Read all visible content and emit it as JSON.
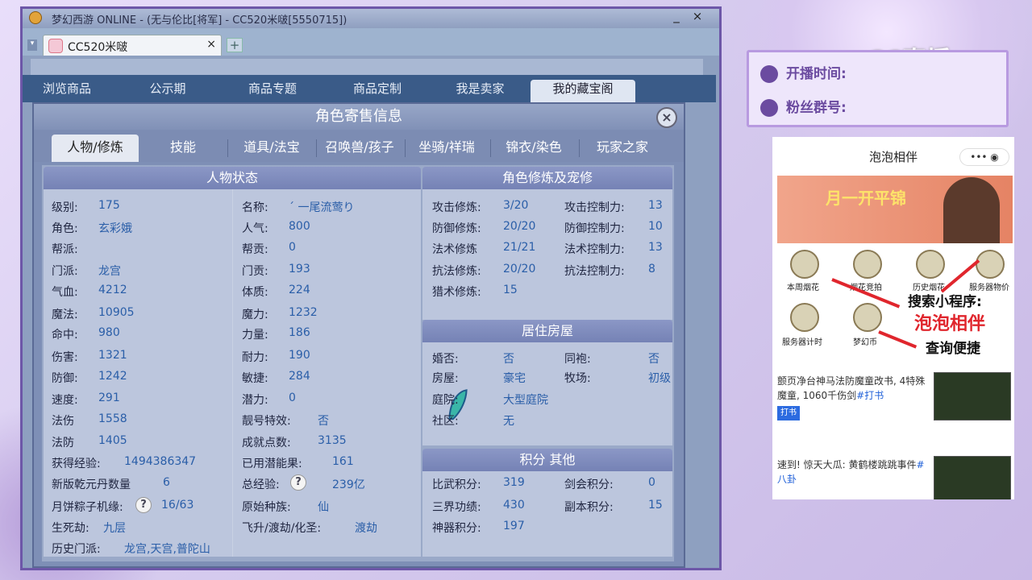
{
  "window": {
    "title": "梦幻西游 ONLINE - (无与伦比[将军] - CC520米啵[5550715])"
  },
  "browser": {
    "tab_label": "CC520米啵",
    "tab_close": "×",
    "new_tab": "+"
  },
  "site_nav": [
    "浏览商品",
    "公示期",
    "商品专题",
    "商品定制",
    "我是卖家",
    "我的藏宝阁"
  ],
  "dialog": {
    "title": "角色寄售信息",
    "close": "×",
    "tabs": [
      "人物/修炼",
      "技能",
      "道具/法宝",
      "召唤兽/孩子",
      "坐骑/祥瑞",
      "锦衣/染色",
      "玩家之家"
    ]
  },
  "char_status": {
    "heading": "人物状态",
    "left": [
      {
        "label": "级别:",
        "value": "175"
      },
      {
        "label": "角色:",
        "value": "玄彩娥"
      },
      {
        "label": "帮派:",
        "value": ""
      },
      {
        "label": "门派:",
        "value": "龙宫"
      },
      {
        "label": "气血:",
        "value": "4212"
      },
      {
        "label": "魔法:",
        "value": "10905"
      },
      {
        "label": "命中:",
        "value": "980"
      },
      {
        "label": "伤害:",
        "value": "1321"
      },
      {
        "label": "防御:",
        "value": "1242"
      },
      {
        "label": "速度:",
        "value": "291"
      },
      {
        "label": "法伤",
        "value": "1558"
      },
      {
        "label": "法防",
        "value": "1405"
      },
      {
        "label": "获得经验:",
        "value": "1494386347"
      },
      {
        "label": "新版乾元丹数量",
        "value": "6"
      },
      {
        "label": "月饼粽子机缘:",
        "value": "16/63"
      },
      {
        "label": "生死劫:",
        "value": "九层"
      },
      {
        "label": "历史门派:",
        "value": "龙宫,天宫,普陀山"
      }
    ],
    "right": [
      {
        "label": "名称:",
        "value": "´ 一尾流莺り"
      },
      {
        "label": "人气:",
        "value": "800"
      },
      {
        "label": "帮贡:",
        "value": "0"
      },
      {
        "label": "门贡:",
        "value": "193"
      },
      {
        "label": "体质:",
        "value": "224"
      },
      {
        "label": "魔力:",
        "value": "1232"
      },
      {
        "label": "力量:",
        "value": "186"
      },
      {
        "label": "耐力:",
        "value": "190"
      },
      {
        "label": "敏捷:",
        "value": "284"
      },
      {
        "label": "潜力:",
        "value": "0"
      },
      {
        "label": "靓号特效:",
        "value": "否"
      },
      {
        "label": "成就点数:",
        "value": "3135"
      },
      {
        "label": "已用潜能果:",
        "value": "161"
      },
      {
        "label": "总经验:",
        "value": "239亿"
      },
      {
        "label": "原始种族:",
        "value": "仙"
      },
      {
        "label": "飞升/渡劫/化圣:",
        "value": "渡劫"
      }
    ],
    "help_icon": "?"
  },
  "cultivation": {
    "heading": "角色修炼及宠修",
    "rows": [
      {
        "l1": "攻击修炼:",
        "v1": "3/20",
        "l2": "攻击控制力:",
        "v2": "13"
      },
      {
        "l1": "防御修炼:",
        "v1": "20/20",
        "l2": "防御控制力:",
        "v2": "10"
      },
      {
        "l1": "法术修炼",
        "v1": "21/21",
        "l2": "法术控制力:",
        "v2": "13"
      },
      {
        "l1": "抗法修炼:",
        "v1": "20/20",
        "l2": "抗法控制力:",
        "v2": "8"
      },
      {
        "l1": "猎术修炼:",
        "v1": "15",
        "l2": "",
        "v2": ""
      }
    ]
  },
  "housing": {
    "heading": "居住房屋",
    "rows": [
      {
        "l1": "婚否:",
        "v1": "否",
        "l2": "同袍:",
        "v2": "否"
      },
      {
        "l1": "房屋:",
        "v1": "豪宅",
        "l2": "牧场:",
        "v2": "初级"
      },
      {
        "l1": "庭院:",
        "v1": "大型庭院",
        "l2": "",
        "v2": ""
      },
      {
        "l1": "社区:",
        "v1": "无",
        "l2": "",
        "v2": ""
      }
    ]
  },
  "points": {
    "heading": "积分 其他",
    "rows": [
      {
        "l1": "比武积分:",
        "v1": "319",
        "l2": "剑会积分:",
        "v2": "0"
      },
      {
        "l1": "三界功绩:",
        "v1": "430",
        "l2": "副本积分:",
        "v2": "15"
      },
      {
        "l1": "神器积分:",
        "v1": "197",
        "l2": "",
        "v2": ""
      }
    ]
  },
  "overlay": {
    "broadcast_time": "开播时间:",
    "fan_group": "粉丝群号:",
    "logo": "CC直播",
    "phone_title": "泡泡相伴",
    "phone_caps": "•••  ◉",
    "banner_text": "月一开平锦",
    "grid_labels": [
      "本周烟花",
      "烟花竞拍",
      "历史烟花",
      "服务器物价",
      "服务器计时",
      "梦幻币"
    ],
    "promo_search": "搜索小程序:",
    "promo_name": "泡泡相伴",
    "promo_query": "查询便捷",
    "news": [
      {
        "text": "颤页净台神马法防魔童改书, 4特殊魔童, 1060千伤剑",
        "tag": "#打书",
        "chip": "打书"
      },
      {
        "text": "速到! 惊天大瓜: 黄鹤楼跳跳事件",
        "tag": "#八卦",
        "chip": ""
      }
    ]
  },
  "colors": {
    "accent": "#6b4ba0",
    "value_text": "#2a5ea8",
    "promo_red": "#e0262d",
    "header": "#7582b5"
  }
}
